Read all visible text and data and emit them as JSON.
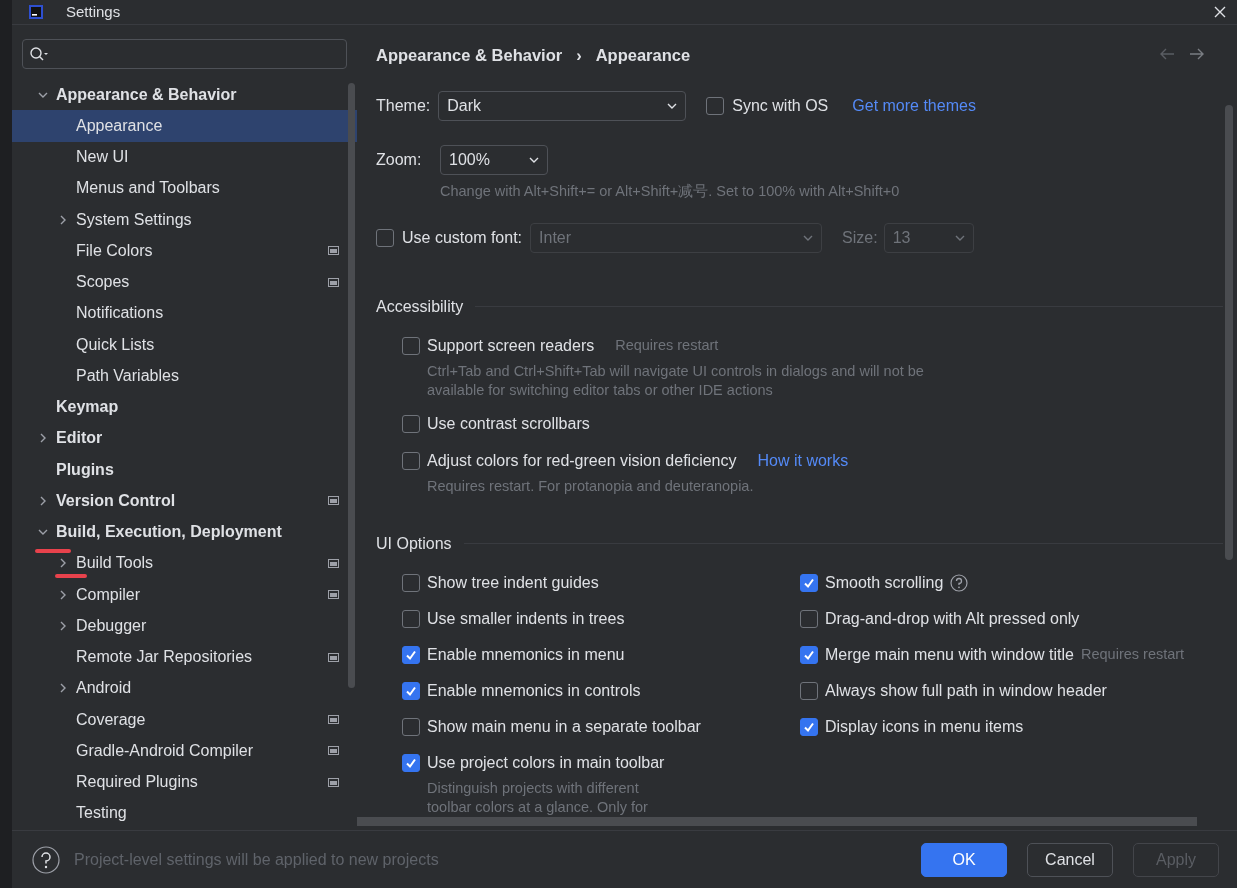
{
  "window": {
    "title": "Settings"
  },
  "sidebar": {
    "items": [
      {
        "label": "Appearance & Behavior",
        "kind": "node",
        "expanded": true,
        "selected": false,
        "project_level": false,
        "children": [
          {
            "label": "Appearance",
            "kind": "leaf",
            "selected": true,
            "project_level": false
          },
          {
            "label": "New UI",
            "kind": "leaf",
            "selected": false,
            "project_level": false
          },
          {
            "label": "Menus and Toolbars",
            "kind": "leaf",
            "selected": false,
            "project_level": false
          },
          {
            "label": "System Settings",
            "kind": "node",
            "expanded": false,
            "selected": false,
            "project_level": false
          },
          {
            "label": "File Colors",
            "kind": "leaf",
            "selected": false,
            "project_level": true
          },
          {
            "label": "Scopes",
            "kind": "leaf",
            "selected": false,
            "project_level": true
          },
          {
            "label": "Notifications",
            "kind": "leaf",
            "selected": false,
            "project_level": false
          },
          {
            "label": "Quick Lists",
            "kind": "leaf",
            "selected": false,
            "project_level": false
          },
          {
            "label": "Path Variables",
            "kind": "leaf",
            "selected": false,
            "project_level": false
          }
        ]
      },
      {
        "label": "Keymap",
        "kind": "leaf",
        "selected": false,
        "project_level": false
      },
      {
        "label": "Editor",
        "kind": "node",
        "expanded": false,
        "selected": false,
        "project_level": false
      },
      {
        "label": "Plugins",
        "kind": "leaf",
        "selected": false,
        "project_level": false
      },
      {
        "label": "Version Control",
        "kind": "node",
        "expanded": false,
        "selected": false,
        "project_level": true
      },
      {
        "label": "Build, Execution, Deployment",
        "kind": "node",
        "expanded": true,
        "selected": false,
        "project_level": false,
        "children": [
          {
            "label": "Build Tools",
            "kind": "node",
            "expanded": false,
            "selected": false,
            "project_level": true
          },
          {
            "label": "Compiler",
            "kind": "node",
            "expanded": false,
            "selected": false,
            "project_level": true
          },
          {
            "label": "Debugger",
            "kind": "node",
            "expanded": false,
            "selected": false,
            "project_level": false
          },
          {
            "label": "Remote Jar Repositories",
            "kind": "leaf",
            "selected": false,
            "project_level": true
          },
          {
            "label": "Android",
            "kind": "node",
            "expanded": false,
            "selected": false,
            "project_level": false
          },
          {
            "label": "Coverage",
            "kind": "leaf",
            "selected": false,
            "project_level": true
          },
          {
            "label": "Gradle-Android Compiler",
            "kind": "leaf",
            "selected": false,
            "project_level": true
          },
          {
            "label": "Required Plugins",
            "kind": "leaf",
            "selected": false,
            "project_level": true
          },
          {
            "label": "Testing",
            "kind": "leaf",
            "selected": false,
            "project_level": false
          }
        ]
      }
    ]
  },
  "breadcrumb": {
    "items": [
      "Appearance & Behavior",
      "Appearance"
    ],
    "separator": "›"
  },
  "appearance": {
    "theme_label": "Theme:",
    "theme_value": "Dark",
    "sync": {
      "label": "Sync with OS",
      "checked": false
    },
    "more_themes_link": "Get more themes",
    "zoom_label": "Zoom:",
    "zoom_value": "100%",
    "zoom_hint": "Change with Alt+Shift+= or Alt+Shift+减号. Set to 100% with Alt+Shift+0",
    "custom_font": {
      "label": "Use custom font:",
      "checked": false,
      "font_value": "Inter",
      "size_label": "Size:",
      "size_value": "13",
      "disabled": true
    }
  },
  "sections": [
    {
      "title": "Accessibility",
      "columns": [
        [
          {
            "label": "Support screen readers",
            "checked": false,
            "note": "Requires restart",
            "description": "Ctrl+Tab and Ctrl+Shift+Tab will navigate UI controls in dialogs and will not be available for switching editor tabs or other IDE actions"
          },
          {
            "label": "Use contrast scrollbars",
            "checked": false
          },
          {
            "label": "Adjust colors for red-green vision deficiency",
            "checked": false,
            "link": "How it works",
            "description": "Requires restart. For protanopia and deuteranopia."
          }
        ]
      ]
    },
    {
      "title": "UI Options",
      "columns": [
        [
          {
            "label": "Show tree indent guides",
            "checked": false
          },
          {
            "label": "Use smaller indents in trees",
            "checked": false
          },
          {
            "label": "Enable mnemonics in menu",
            "checked": true
          },
          {
            "label": "Enable mnemonics in controls",
            "checked": true
          },
          {
            "label": "Show main menu in a separate toolbar",
            "checked": false
          },
          {
            "label": "Use project colors in main toolbar",
            "checked": true,
            "description": "Distinguish projects with different toolbar colors at a glance. Only for"
          }
        ],
        [
          {
            "label": "Smooth scrolling",
            "checked": true,
            "help_icon": true
          },
          {
            "label": "Drag-and-drop with Alt pressed only",
            "checked": false
          },
          {
            "label": "Merge main menu with window title",
            "checked": true,
            "note": "Requires restart"
          },
          {
            "label": "Always show full path in window header",
            "checked": false
          },
          {
            "label": "Display icons in menu items",
            "checked": true
          }
        ]
      ]
    }
  ],
  "footer": {
    "hint": "Project-level settings will be applied to new projects",
    "buttons": [
      {
        "label": "OK",
        "kind": "primary",
        "disabled": false
      },
      {
        "label": "Cancel",
        "kind": "secondary",
        "disabled": false
      },
      {
        "label": "Apply",
        "kind": "secondary",
        "disabled": true
      }
    ]
  }
}
